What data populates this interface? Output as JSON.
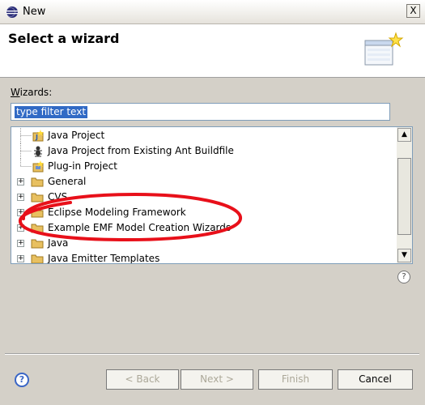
{
  "window": {
    "title": "New",
    "close_label": "X"
  },
  "banner": {
    "title": "Select a wizard"
  },
  "wizards": {
    "label": "izards:",
    "label_accel": "W"
  },
  "filter": {
    "value": "type filter text",
    "placeholder": "type filter text"
  },
  "tree": {
    "items": [
      {
        "label": "Java Project"
      },
      {
        "label": "Java Project from Existing Ant Buildfile"
      },
      {
        "label": "Plug-in Project"
      },
      {
        "label": "General"
      },
      {
        "label": "CVS"
      },
      {
        "label": "Eclipse Modeling Framework"
      },
      {
        "label": "Example EMF Model Creation Wizards"
      },
      {
        "label": "Java"
      },
      {
        "label": "Java Emitter Templates"
      }
    ]
  },
  "buttons": {
    "back": "< Back",
    "next": "Next >",
    "finish": "Finish",
    "cancel": "Cancel"
  },
  "help": {
    "symbol": "?"
  },
  "colors": {
    "selection": "#316ac5",
    "annotation": "#e8101a",
    "folder": "#e8c060"
  },
  "icons": {
    "title": "eclipse-icon",
    "banner": "wizard-icon",
    "help": "help-icon",
    "folder": "folder-icon",
    "project": "java-project-icon"
  }
}
